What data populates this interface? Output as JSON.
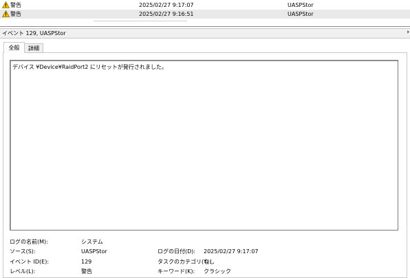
{
  "events": [
    {
      "level": "警告",
      "datetime": "2025/02/27 9:17:07",
      "source": "UASPStor",
      "selected": false
    },
    {
      "level": "警告",
      "datetime": "2025/02/27 9:16:51",
      "source": "UASPStor",
      "selected": true
    }
  ],
  "header": {
    "title": "イベント 129, UASPStor"
  },
  "tabs": {
    "general": "全般",
    "details": "詳細"
  },
  "message": "デバイス ¥Device¥RaidPort2 にリセットが発行されました。",
  "props": {
    "log_name_label": "ログの名前(M):",
    "log_name": "システム",
    "source_label": "ソース(S):",
    "source": "UASPStor",
    "logged_label": "ログの日付(D):",
    "logged": "2025/02/27 9:17:07",
    "event_id_label": "イベント ID(E):",
    "event_id": "129",
    "task_label": "タスクのカテゴリ(Y):",
    "task": "なし",
    "level_label": "レベル(L):",
    "level": "警告",
    "keywords_label": "キーワード(K):",
    "keywords": "クラシック"
  },
  "colors": {
    "warning": "#f2c200",
    "selected_row": "#e9e9e9"
  }
}
